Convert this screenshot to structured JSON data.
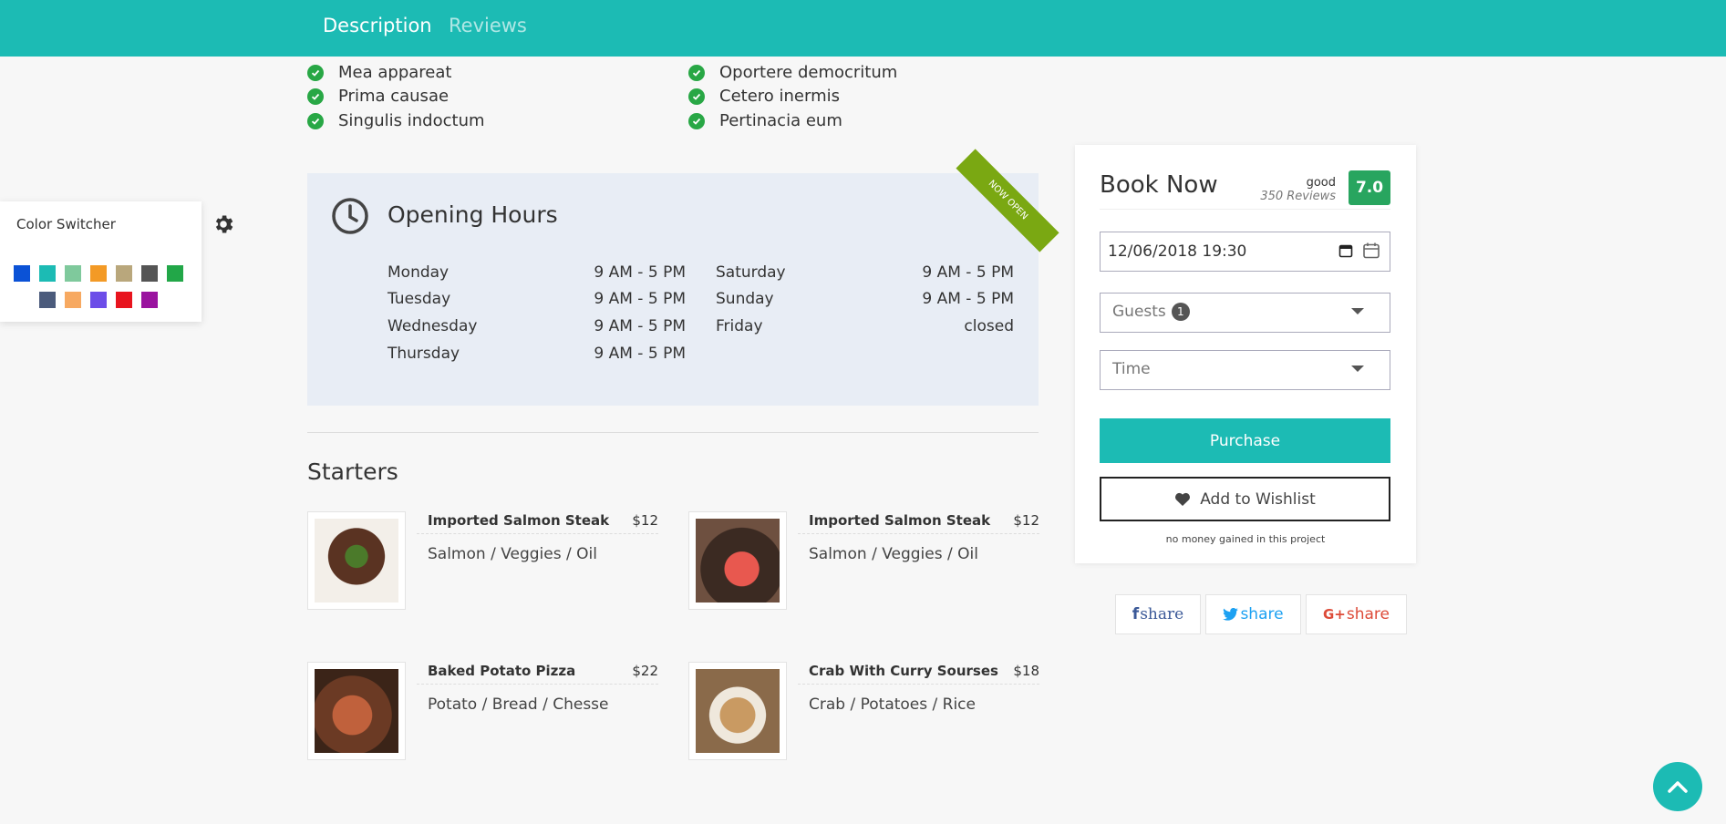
{
  "tabs": [
    {
      "label": "Description",
      "active": true
    },
    {
      "label": "Reviews",
      "active": false
    }
  ],
  "features": {
    "left": [
      "Mea appareat",
      "Prima causae",
      "Singulis indoctum"
    ],
    "right": [
      "Oportere democritum",
      "Cetero inermis",
      "Pertinacia eum"
    ]
  },
  "color_switcher": {
    "title": "Color Switcher",
    "colors": [
      "#0b52d6",
      "#1cbbb4",
      "#7fc99c",
      "#f39a26",
      "#b9a77c",
      "#555555",
      "#22a748",
      "#4b5b7c",
      "#f7a961",
      "#6c4de8",
      "#e8141e",
      "#9a139f"
    ]
  },
  "opening_hours": {
    "title": "Opening Hours",
    "ribbon": "NOW OPEN",
    "left": [
      {
        "day": "Monday",
        "hours": "9 AM - 5 PM"
      },
      {
        "day": "Tuesday",
        "hours": "9 AM - 5 PM"
      },
      {
        "day": "Wednesday",
        "hours": "9 AM - 5 PM"
      },
      {
        "day": "Thursday",
        "hours": "9 AM - 5 PM"
      }
    ],
    "right": [
      {
        "day": "Saturday",
        "hours": "9 AM - 5 PM"
      },
      {
        "day": "Sunday",
        "hours": "9 AM - 5 PM"
      },
      {
        "day": "Friday",
        "hours": "closed"
      }
    ]
  },
  "starters": {
    "title": "Starters",
    "items": [
      {
        "name": "Imported Salmon Steak",
        "price": "$12",
        "desc": "Salmon / Veggies / Oil"
      },
      {
        "name": "Imported Salmon Steak",
        "price": "$12",
        "desc": "Salmon / Veggies / Oil"
      },
      {
        "name": "Baked Potato Pizza",
        "price": "$22",
        "desc": "Potato / Bread / Chesse"
      },
      {
        "name": "Crab With Curry Sourses",
        "price": "$18",
        "desc": "Crab / Potatoes / Rice"
      }
    ]
  },
  "booking": {
    "title": "Book Now",
    "rating_word": "good",
    "reviews": "350 Reviews",
    "score": "7.0",
    "date_value": "12/06/2018 19:30",
    "guests_placeholder": "Guests",
    "guests_count": "1",
    "time_placeholder": "Time",
    "purchase_label": "Purchase",
    "wishlist_label": "Add to Wishlist",
    "note": "no money gained in this project"
  },
  "share": {
    "facebook": "share",
    "twitter": "share",
    "google": "share",
    "facebook_color": "#3b5998",
    "twitter_color": "#1da1f2",
    "google_color": "#dd4b39"
  }
}
